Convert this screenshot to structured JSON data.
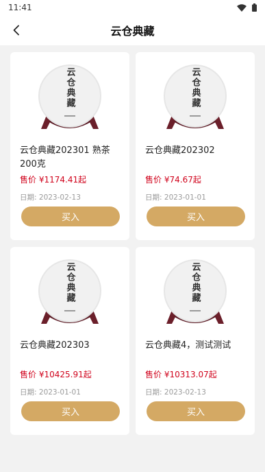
{
  "status_bar": {
    "time": "11:41"
  },
  "header": {
    "title": "云仓典藏"
  },
  "product_image_text": "云仓典藏",
  "products": [
    {
      "name": "云仓典藏202301 熟茶200克",
      "price_label": "售价",
      "price": "¥1174.41起",
      "date_label": "日期:",
      "date": "2023-02-13",
      "buy_label": "买入"
    },
    {
      "name": "云仓典藏202302",
      "price_label": "售价",
      "price": "¥74.67起",
      "date_label": "日期:",
      "date": "2023-01-01",
      "buy_label": "买入"
    },
    {
      "name": "云仓典藏202303",
      "price_label": "售价",
      "price": "¥10425.91起",
      "date_label": "日期:",
      "date": "2023-01-01",
      "buy_label": "买入"
    },
    {
      "name": "云仓典藏4，测试测试",
      "price_label": "售价",
      "price": "¥10313.07起",
      "date_label": "日期:",
      "date": "2023-02-13",
      "buy_label": "买入"
    }
  ],
  "colors": {
    "accent": "#d4a964",
    "price": "#d0021b",
    "background": "#f2f2f2"
  },
  "icons": {
    "back": "chevron-left-icon",
    "wifi": "wifi-icon",
    "battery": "battery-icon"
  }
}
